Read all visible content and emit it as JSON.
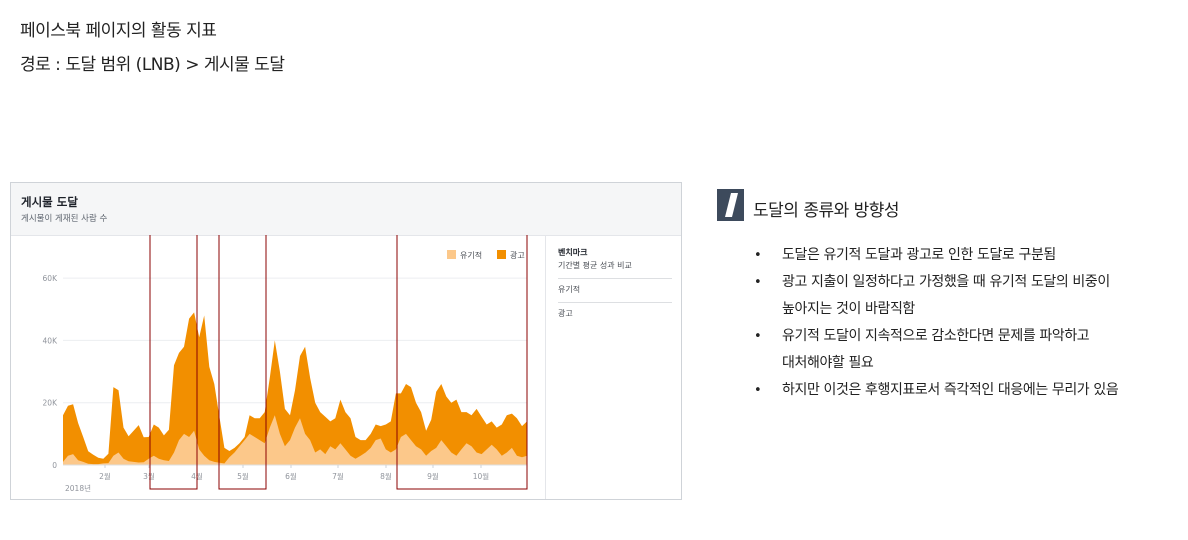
{
  "header": {
    "line1": "페이스북 페이지의 활동 지표",
    "line2": "경로 : 도달 범위 (LNB) > 게시물 도달"
  },
  "panel": {
    "title": "게시물 도달",
    "subtitle": "게시물이 게재된 사람 수"
  },
  "sidebar": {
    "benchmark_title": "벤치마크",
    "benchmark_sub": "기간별 평균 성과 비교",
    "organic": "유기적",
    "paid": "광고"
  },
  "notes": {
    "icon": "slash-bar-icon",
    "title": "도달의 종류와 방향성",
    "bullets": [
      [
        "도달은 유기적 도달과 광고로 인한 도달로 구분됨"
      ],
      [
        "광고 지출이 일정하다고 가정했을 때 유기적 도달의 비중이",
        "높아지는 것이 바람직함"
      ],
      [
        "유기적 도달이 지속적으로 감소한다면 문제를 파악하고",
        "대처해야할 필요"
      ],
      [
        "하지만 이것은 후행지표로서 즉각적인 대응에는 무리가 있음"
      ]
    ]
  },
  "colors": {
    "organic": "#fcc88a",
    "paid": "#f28f00",
    "highlight": "#8b0000"
  },
  "chart_data": {
    "type": "area",
    "stacked": true,
    "y_ticks": [
      "0",
      "20K",
      "40K",
      "60K"
    ],
    "ylim": [
      0,
      70000
    ],
    "x_tick_labels": [
      "2월",
      "3월",
      "4월",
      "5월",
      "6월",
      "7월",
      "8월",
      "9월",
      "10월"
    ],
    "year_label": "2018년",
    "legend_position": "top-right",
    "series": [
      {
        "name": "유기적",
        "values": [
          1000,
          3000,
          3500,
          1500,
          1000,
          400,
          300,
          300,
          500,
          600,
          3000,
          4000,
          2000,
          1200,
          1000,
          800,
          900,
          2000,
          3000,
          2000,
          1500,
          1300,
          4000,
          8000,
          10000,
          9000,
          11000,
          5000,
          3000,
          1500,
          1000,
          700,
          500,
          2500,
          4000,
          6000,
          8000,
          10000,
          9000,
          8000,
          7000,
          12000,
          16000,
          10000,
          6000,
          8000,
          12000,
          15000,
          10000,
          8000,
          4000,
          5000,
          3500,
          6000,
          5000,
          7000,
          5000,
          3000,
          2000,
          3000,
          4000,
          5500,
          8000,
          8500,
          5000,
          4000,
          5000,
          9000,
          10000,
          8000,
          6000,
          5000,
          3000,
          4500,
          5500,
          8000,
          6000,
          4000,
          3000,
          5000,
          7000,
          6000,
          4000,
          3500,
          5000,
          6500,
          5000,
          3000,
          4000,
          5500,
          3000,
          2500,
          3000
        ]
      },
      {
        "name": "광고",
        "values": [
          15000,
          16000,
          16000,
          12000,
          8000,
          4000,
          3000,
          2000,
          1500,
          3000,
          22000,
          20000,
          10000,
          8000,
          10000,
          12000,
          8000,
          7000,
          10000,
          10000,
          8000,
          10000,
          28000,
          28000,
          28000,
          38000,
          38000,
          36000,
          45000,
          30000,
          25000,
          15000,
          5000,
          2000,
          1500,
          1000,
          1000,
          6000,
          6000,
          7000,
          10000,
          16000,
          24000,
          20000,
          12000,
          8000,
          12000,
          20000,
          28000,
          20000,
          16000,
          12000,
          12000,
          8000,
          10000,
          14000,
          12000,
          12000,
          7000,
          5000,
          4000,
          4500,
          5000,
          4000,
          8000,
          10000,
          18000,
          14000,
          16000,
          17000,
          14000,
          12000,
          8000,
          10000,
          18000,
          18000,
          16000,
          16000,
          18000,
          12000,
          10000,
          10000,
          14000,
          12000,
          8000,
          7500,
          7000,
          10000,
          12000,
          11000,
          12000,
          10000,
          11000
        ]
      }
    ]
  }
}
